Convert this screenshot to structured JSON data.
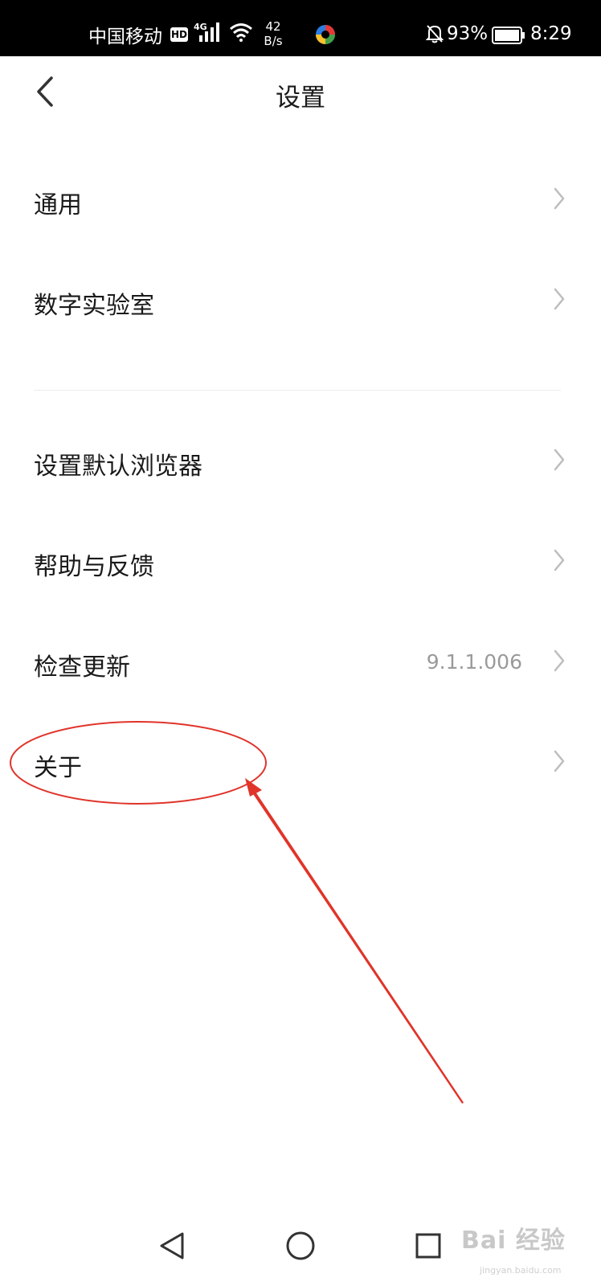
{
  "status_bar": {
    "carrier": "中国移动",
    "hd": "HD",
    "network": "4G",
    "speed_value": "42",
    "speed_unit": "B/s",
    "battery": "93%",
    "time": "8:29"
  },
  "header": {
    "title": "设置"
  },
  "settings": {
    "general": {
      "label": "通用"
    },
    "digital_lab": {
      "label": "数字实验室"
    },
    "default_browser": {
      "label": "设置默认浏览器"
    },
    "help_feedback": {
      "label": "帮助与反馈"
    },
    "check_update": {
      "label": "检查更新",
      "value": "9.1.1.006"
    },
    "about": {
      "label": "关于"
    }
  },
  "watermark": {
    "text": "Bai 经验",
    "url": "jingyan.baidu.com"
  },
  "icons": {
    "back": "chevron-left-icon",
    "chevron": "chevron-right-icon",
    "nav_back": "triangle-back-icon",
    "nav_home": "circle-home-icon",
    "nav_recents": "square-recents-icon"
  },
  "colors": {
    "annotation": "#e0342a",
    "status_bar_bg": "#000000",
    "secondary_text": "#9a9a9a"
  }
}
